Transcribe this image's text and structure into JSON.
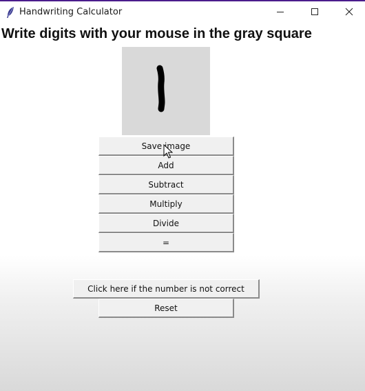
{
  "window": {
    "title": "Handwriting Calculator",
    "icon": "feather-icon",
    "controls": [
      "minimize-icon",
      "maximize-icon",
      "close-icon"
    ]
  },
  "heading": "Write digits with your mouse in the gray square",
  "canvas": {
    "background": "#d9d9d9",
    "drawn_digit": "1"
  },
  "buttons": {
    "save": "Save image",
    "add": "Add",
    "subtract": "Subtract",
    "multiply": "Multiply",
    "divide": "Divide",
    "equals": "=",
    "incorrect": "Click here if the number is not correct",
    "reset": "Reset"
  },
  "colors": {
    "accent": "#4a1c8c",
    "canvas": "#d9d9d9",
    "button_face": "#f0f0f0"
  }
}
